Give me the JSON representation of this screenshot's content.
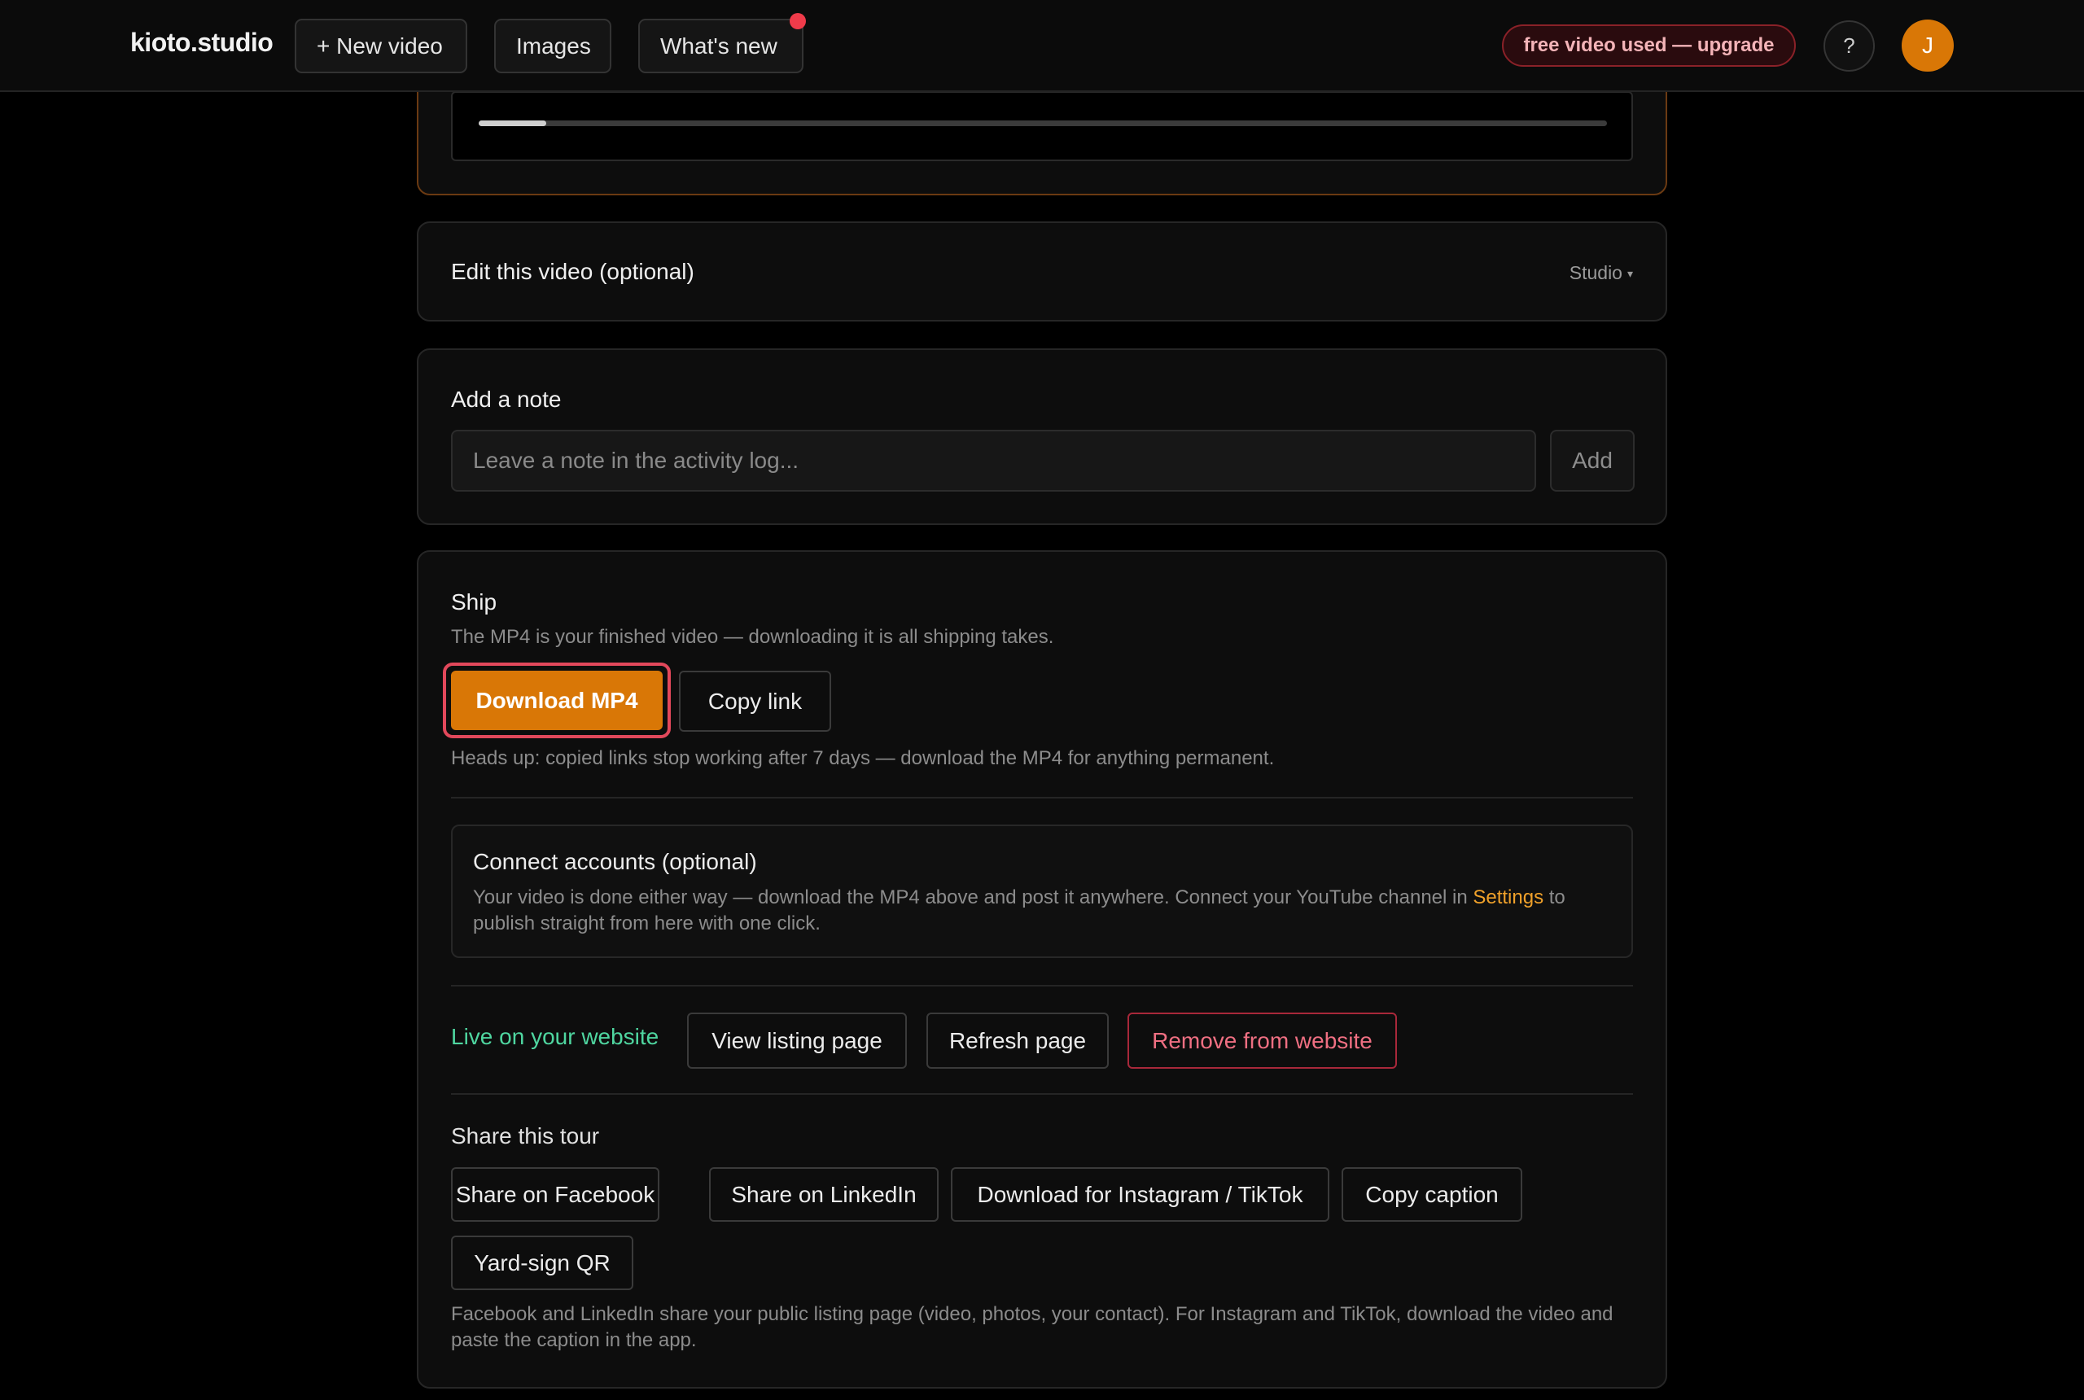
{
  "nav": {
    "brand": "kioto.studio",
    "new_video": "+ New video",
    "images": "Images",
    "whats_new": "What's new",
    "upgrade": "free video used — upgrade",
    "help": "?",
    "avatar_initial": "J"
  },
  "player": {
    "progress": 0.06
  },
  "edit": {
    "title": "Edit this video (optional)",
    "mode": "Studio"
  },
  "note": {
    "title": "Add a note",
    "placeholder": "Leave a note in the activity log...",
    "add_label": "Add"
  },
  "ship": {
    "title": "Ship",
    "subtitle": "The MP4 is your finished video — downloading it is all shipping takes.",
    "download_label": "Download MP4",
    "copy_link_label": "Copy link",
    "heads_up": "Heads up: copied links stop working after 7 days — download the MP4 for anything permanent.",
    "connect": {
      "title": "Connect accounts (optional)",
      "text_before": "Your video is done either way — download the MP4 above and post it anywhere. Connect your YouTube channel in ",
      "link": "Settings",
      "text_after": " to publish straight from here with one click."
    },
    "live_status": "Live on your website",
    "view_listing": "View listing page",
    "refresh_page": "Refresh page",
    "remove_website": "Remove from website",
    "share": {
      "title": "Share this tour",
      "facebook": "Share on Facebook",
      "linkedin": "Share on LinkedIn",
      "instagram": "Download for Instagram / TikTok",
      "copy_caption": "Copy caption",
      "qr": "Yard-sign QR",
      "note": "Facebook and LinkedIn share your public listing page (video, photos, your contact). For Instagram and TikTok, download the video and paste the caption in the app."
    }
  },
  "colors": {
    "accent": "#d97706",
    "live": "#4fd6a0",
    "danger": "#ef6f82",
    "link": "#f0a12a"
  }
}
